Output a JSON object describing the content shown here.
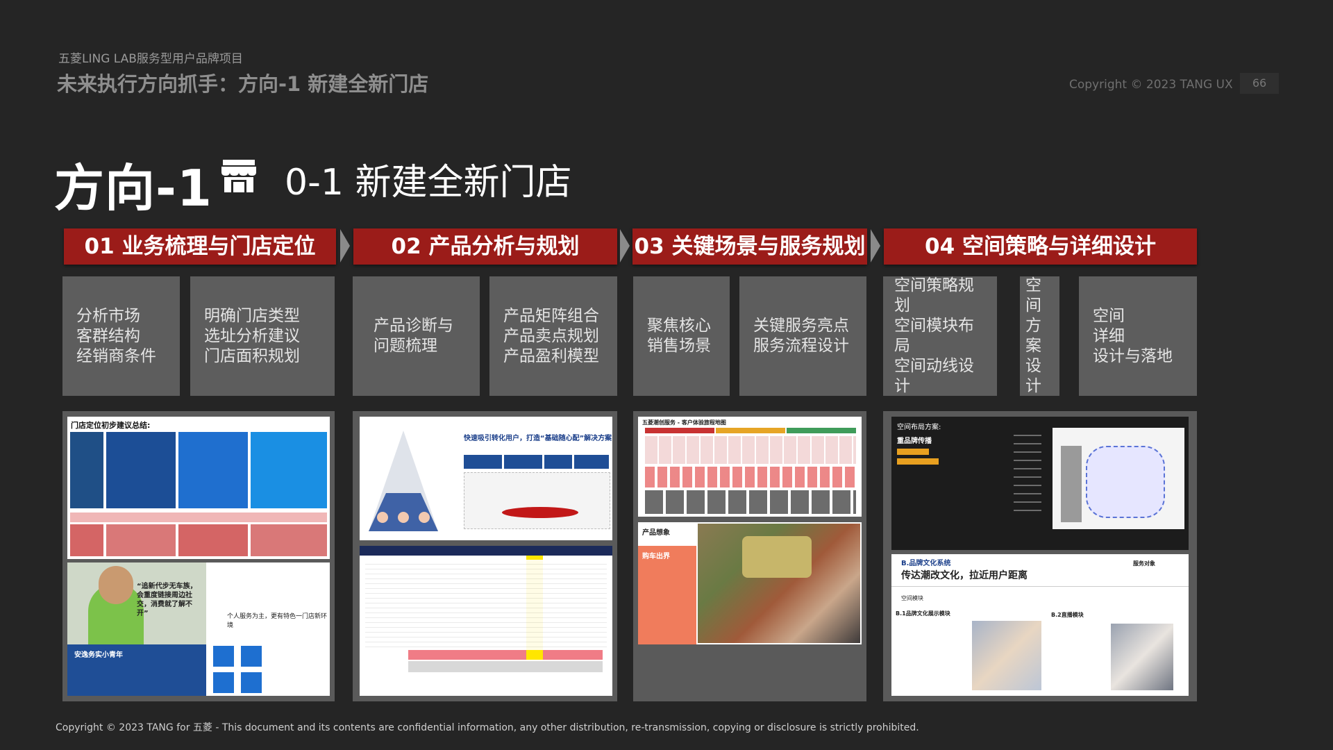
{
  "header": {
    "project": "五菱LING LAB服务型用户品牌项目",
    "subtitle": "未来执行方向抓手：方向-1 新建全新门店",
    "copyright": "Copyright © 2023 TANG UX",
    "page_number": "66"
  },
  "direction": {
    "label": "方向-1",
    "icon": "store-icon",
    "title": "0-1 新建全新门店"
  },
  "phases": [
    {
      "label": "01 业务梳理与门店定位",
      "tasks": [
        "分析市场\n客群结构\n经销商条件",
        "明确门店类型\n选址分析建议\n门店面积规划"
      ]
    },
    {
      "label": "02  产品分析与规划",
      "tasks": [
        "产品诊断与\n问题梳理",
        "产品矩阵组合\n产品卖点规划\n产品盈利模型"
      ]
    },
    {
      "label": "03  关键场景与服务规划",
      "tasks": [
        "聚焦核心\n销售场景",
        "关键服务亮点\n服务流程设计"
      ]
    },
    {
      "label": "04 空间策略与详细设计",
      "tasks": [
        "空间策略规划\n空间模块布局\n空间动线设计",
        "空间\n方案\n设计",
        "空间\n详细\n设计与落地"
      ]
    }
  ],
  "previews": {
    "p1_title": "门店定位初步建议总结:",
    "p1_persona_quote": "“追新代步无车族，会重度链接周边社交，消费就了解不开”",
    "p1_persona_name": "安逸务实小青年",
    "p1_note": "个人服务为主，更有特色一门店新环境",
    "p2_headline": "快速吸引转化用户，打造“基础随心配”解决方案",
    "p3_title": "五菱潮创服务 - 客户体验旅程地图",
    "p3_label": "产品想象",
    "p3_sub": "购车出界",
    "p4_title": "空间布局方案:",
    "p4_sub": "重品牌传播",
    "p4_b_label": "B.品牌文化系统",
    "p4_b_title": "传达潮改文化，拉近用户距离",
    "p4_service": "服务对象",
    "p4_module": "空间模块",
    "p4_b1": "B.1品牌文化展示模块",
    "p4_b2": "B.2直播模块"
  },
  "colors": {
    "background": "#252525",
    "phase_red": "#9b1c19",
    "task_gray": "#5d5d5d",
    "panel_gray": "#5a5a5a"
  },
  "footer": "Copyright © 2023 TANG for 五菱 - This document and its contents are confidential information, any other distribution, re-transmission, copying or disclosure is strictly prohibited."
}
